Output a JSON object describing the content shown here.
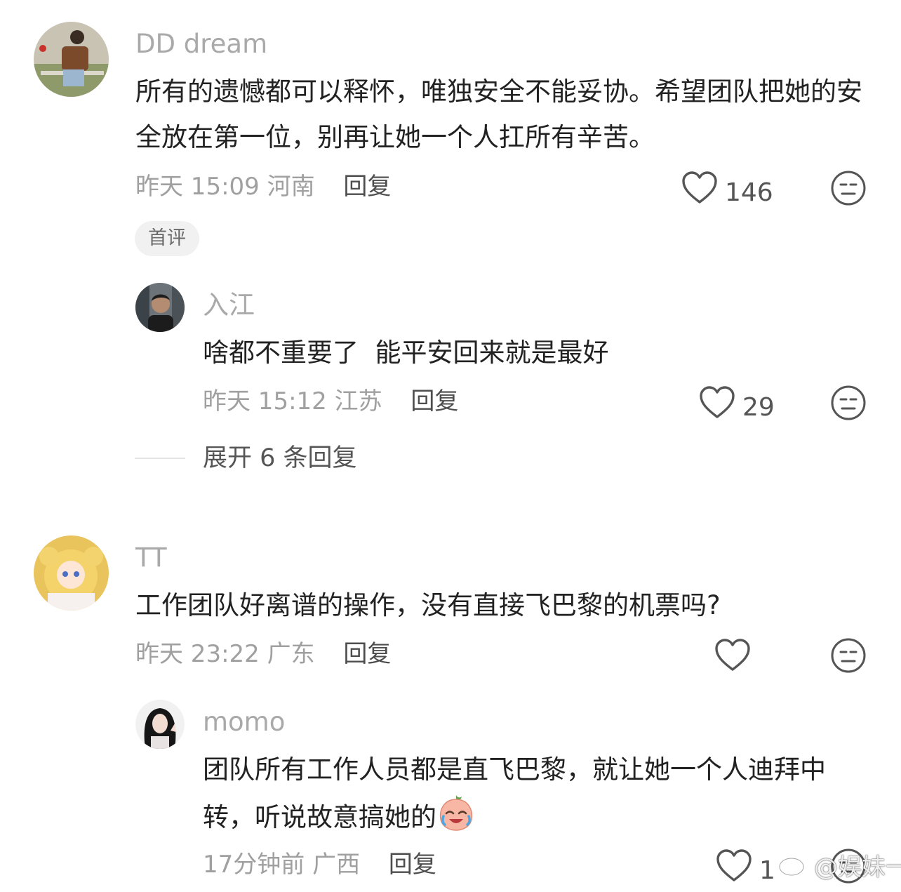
{
  "colors": {
    "name": "#a9a9a9",
    "text": "#222222",
    "meta": "#a0a0a0",
    "badge_bg": "#f1f1f1"
  },
  "comments": [
    {
      "username": "DD dream",
      "text": "所有的遗憾都可以释怀，唯独安全不能妥协。希望团队把她的安全放在第一位，别再让她一个人扛所有辛苦。",
      "time": "昨天 15:09",
      "location": "河南",
      "reply_label": "回复",
      "likes": "146",
      "badge": "首评",
      "replies": [
        {
          "username": "入江",
          "text": "啥都不重要了  能平安回来就是最好",
          "time": "昨天 15:12",
          "location": "江苏",
          "reply_label": "回复",
          "likes": "29"
        }
      ],
      "expand_label": "展开 6 条回复"
    },
    {
      "username": "TT",
      "text": "工作团队好离谱的操作，没有直接飞巴黎的机票吗?",
      "time": "昨天 23:22",
      "location": "广东",
      "reply_label": "回复",
      "likes": "",
      "replies": [
        {
          "username": "momo",
          "text": "团队所有工作人员都是直飞巴黎，就让她一个人迪拜中转，听说故意搞她的",
          "emoji": "crying-laughing-peach-emoji",
          "time": "17分钟前",
          "location": "广西",
          "reply_label": "回复",
          "likes": "1"
        }
      ]
    }
  ],
  "watermark": "@娱妹一"
}
